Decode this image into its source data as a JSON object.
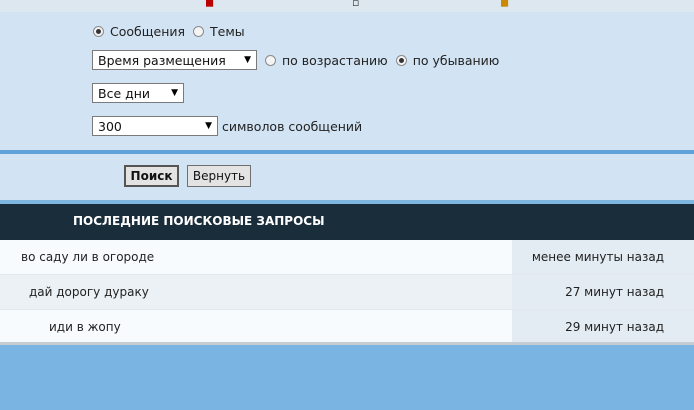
{
  "search_form": {
    "scope_options": [
      {
        "label": "Сообщения",
        "selected": true
      },
      {
        "label": "Темы",
        "selected": false
      }
    ],
    "sort_by": {
      "value": "Время размещения"
    },
    "sort_order": [
      {
        "label": "по возрастанию",
        "selected": false
      },
      {
        "label": "по убыванию",
        "selected": true
      }
    ],
    "date_range": {
      "value": "Все дни"
    },
    "chars": {
      "value": "300",
      "suffix": "символов сообщений"
    },
    "search_button": "Поиск",
    "reset_button": "Вернуть"
  },
  "recent": {
    "header": "ПОСЛЕДНИЕ ПОИСКОВЫЕ ЗАПРОСЫ",
    "rows": [
      {
        "query": "во саду ли в огороде",
        "time": "менее минуты назад"
      },
      {
        "query": "дай дорогу дураку",
        "time": "27 минут назад"
      },
      {
        "query": "иди в жопу",
        "time": "29 минут назад"
      }
    ]
  },
  "colors": {
    "panel": "#d2e3f3",
    "accent": "#5fa0d6",
    "header": "#1a2d3b",
    "background": "#7ab4e2"
  }
}
